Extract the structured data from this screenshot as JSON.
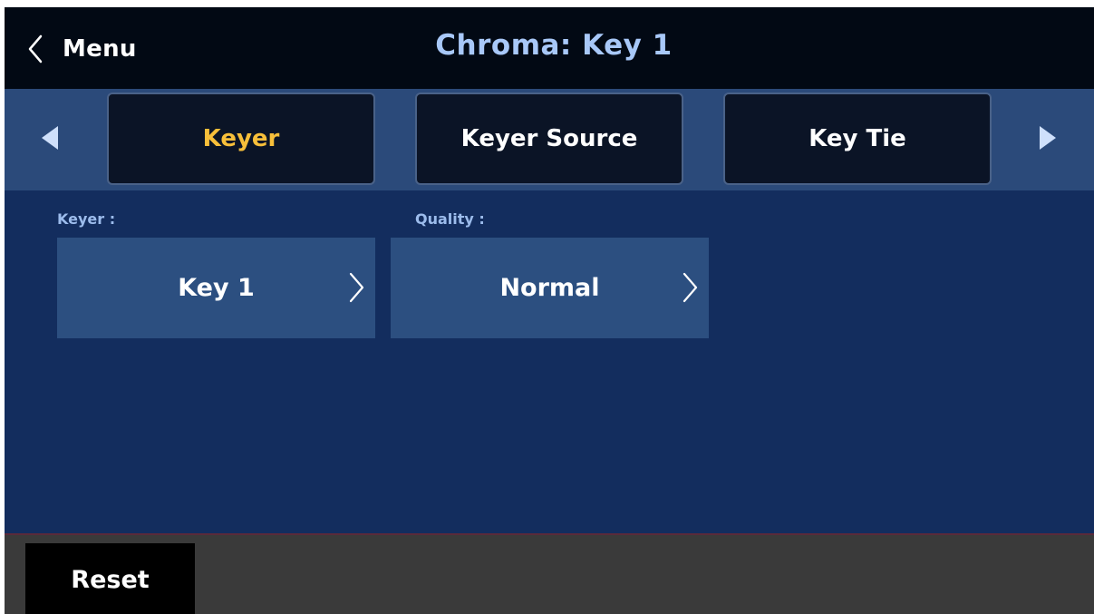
{
  "header": {
    "back_label": "Menu",
    "title": "Chroma: Key 1"
  },
  "tabs": [
    {
      "label": "Keyer",
      "active": true
    },
    {
      "label": "Keyer Source",
      "active": false
    },
    {
      "label": "Key Tie",
      "active": false
    }
  ],
  "fields": {
    "keyer": {
      "label": "Keyer :",
      "value": "Key 1"
    },
    "quality": {
      "label": "Quality :",
      "value": "Normal"
    }
  },
  "footer": {
    "reset_label": "Reset"
  },
  "icons": {
    "back": "chevron-left-icon",
    "prev": "arrow-left-icon",
    "next": "arrow-right-icon",
    "field_chevron": "chevron-right-icon"
  },
  "colors": {
    "header_bg": "#020914",
    "title": "#a8c8f8",
    "tabbar_bg": "#2b4a7a",
    "tab_bg": "#0b1426",
    "active_tab_text": "#f7bf3a",
    "content_bg": "#132d5e",
    "field_bg": "#2c4f80",
    "field_label": "#9cbcec",
    "footer_bg": "#3a3a3a"
  }
}
